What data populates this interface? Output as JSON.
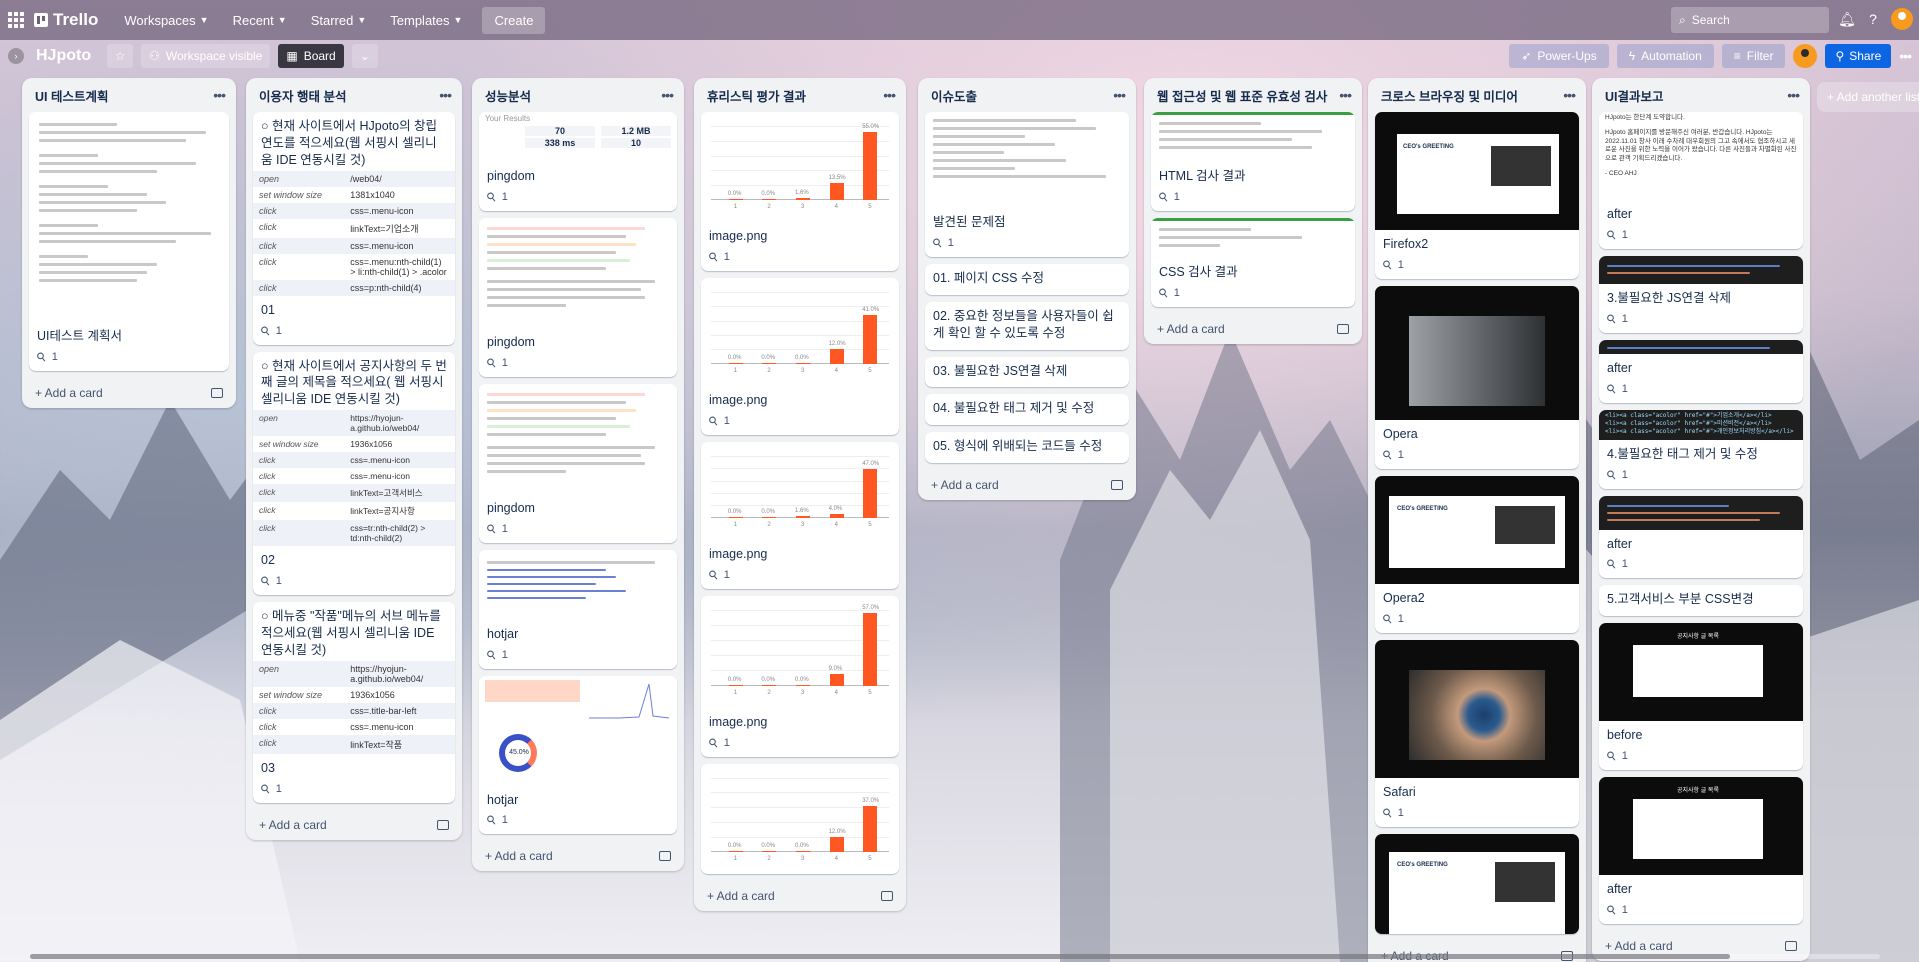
{
  "topnav": {
    "brand": "Trello",
    "menus": [
      "Workspaces",
      "Recent",
      "Starred",
      "Templates"
    ],
    "create_label": "Create",
    "search_placeholder": "Search"
  },
  "board": {
    "title": "HJpoto",
    "visibility_label": "Workspace visible",
    "view_label": "Board",
    "powerups_label": "Power-Ups",
    "automation_label": "Automation",
    "filter_label": "Filter",
    "share_label": "Share",
    "add_list_label": "+ Add another list"
  },
  "add_card_label": "+ Add a card",
  "lists": [
    {
      "title": "UI 테스트계획",
      "cards": [
        {
          "title": "UI테스트 계획서",
          "attachments": "1"
        }
      ]
    },
    {
      "title": "이용자 행태 분석",
      "cards": [
        {
          "title": "○ 현재 사이트에서 HJpoto의 창립 연도를 적으세요(웹 서핑시 셀리니움 IDE 연동시킬 것)",
          "rows": [
            [
              "open",
              "/web04/"
            ],
            [
              "set window size",
              "1381x1040"
            ],
            [
              "click",
              "css=.menu-icon"
            ],
            [
              "click",
              "linkText=기업소개"
            ],
            [
              "click",
              "css=.menu-icon"
            ],
            [
              "click",
              "css=.menu:nth-child(1) > li:nth-child(1) > .acolor"
            ],
            [
              "click",
              "css=p:nth-child(4)"
            ]
          ],
          "label": "01",
          "attachments": "1"
        },
        {
          "title": "○ 현재 사이트에서 공지사항의 두 번째 글의 제목을 적으세요( 웹 서핑시 셀리니움 IDE 연동시킬 것)",
          "rows": [
            [
              "open",
              "https://hyojun-a.github.io/web04/"
            ],
            [
              "set window size",
              "1936x1056"
            ],
            [
              "click",
              "css=.menu-icon"
            ],
            [
              "click",
              "css=.menu-icon"
            ],
            [
              "click",
              "linkText=고객서비스"
            ],
            [
              "click",
              "linkText=공지사항"
            ],
            [
              "click",
              "css=tr:nth-child(2) > td:nth-child(2)"
            ]
          ],
          "label": "02",
          "attachments": "1"
        },
        {
          "title": "○ 메뉴중 \"작품\"메뉴의 서브 메뉴를 적으세요(웹 서핑시 셀리니움 IDE 연동시킬 것)",
          "rows": [
            [
              "open",
              "https://hyojun-a.github.io/web04/"
            ],
            [
              "set window size",
              "1936x1056"
            ],
            [
              "click",
              "css=.title-bar-left"
            ],
            [
              "click",
              "css=.menu-icon"
            ],
            [
              "click",
              "linkText=작품"
            ]
          ],
          "label": "03",
          "attachments": "1"
        }
      ]
    },
    {
      "title": "성능분석",
      "cards": [
        {
          "title": "pingdom",
          "attachments": "1",
          "cover_heading": "Your Results",
          "stats": [
            "70",
            "1.2 MB",
            "338 ms",
            "10"
          ]
        },
        {
          "title": "pingdom",
          "attachments": "1"
        },
        {
          "title": "pingdom",
          "attachments": "1"
        },
        {
          "title": "hotjar",
          "attachments": "1"
        },
        {
          "title": "hotjar",
          "attachments": "1",
          "donut_label": "45.0%"
        }
      ]
    },
    {
      "title": "휴리스틱 평가 결과",
      "cards": [
        {
          "title": "image.png",
          "attachments": "1",
          "chart_data": {
            "type": "bar",
            "categories": [
              "1",
              "2",
              "3",
              "4",
              "5"
            ],
            "values": [
              0.0,
              0.0,
              1.6,
              13.5,
              55.0
            ]
          }
        },
        {
          "title": "image.png",
          "attachments": "1",
          "chart_data": {
            "type": "bar",
            "categories": [
              "1",
              "2",
              "3",
              "4",
              "5"
            ],
            "values": [
              0.0,
              0.0,
              0.0,
              12.0,
              41.0
            ]
          }
        },
        {
          "title": "image.png",
          "attachments": "1",
          "chart_data": {
            "type": "bar",
            "categories": [
              "1",
              "2",
              "3",
              "4",
              "5"
            ],
            "values": [
              0.0,
              0.0,
              1.6,
              4.0,
              47.0
            ]
          }
        },
        {
          "title": "image.png",
          "attachments": "1",
          "chart_data": {
            "type": "bar",
            "categories": [
              "1",
              "2",
              "3",
              "4",
              "5"
            ],
            "values": [
              0.0,
              0.0,
              0.0,
              9.0,
              57.0
            ]
          }
        },
        {
          "title": "",
          "attachments": "",
          "chart_data": {
            "type": "bar",
            "categories": [
              "1",
              "2",
              "3",
              "4",
              "5"
            ],
            "values": [
              0.0,
              0.0,
              0.0,
              12.0,
              37.0
            ]
          }
        }
      ]
    },
    {
      "title": "이슈도출",
      "cards": [
        {
          "title": "발견된 문제점",
          "attachments": "1"
        },
        {
          "title": "01. 페이지 CSS 수정"
        },
        {
          "title": "02. 중요한 정보들을 사용자들이 쉽게 확인 할 수 있도록 수정"
        },
        {
          "title": "03. 불필요한 JS연결 삭제"
        },
        {
          "title": "04. 불필요한 태그 제거 및 수정"
        },
        {
          "title": "05. 형식에 위배되는 코드들 수정"
        }
      ]
    },
    {
      "title": "웹 접근성 및 웹 표준 유효성 검사",
      "cards": [
        {
          "title": "HTML 검사 결과",
          "attachments": "1"
        },
        {
          "title": "CSS 검사 결과",
          "attachments": "1"
        }
      ]
    },
    {
      "title": "크로스 브라우징 및 미디어",
      "cards": [
        {
          "title": "Firefox2",
          "attachments": "1",
          "cover_caption": "CEO's GREETING"
        },
        {
          "title": "Opera",
          "attachments": "1"
        },
        {
          "title": "Opera2",
          "attachments": "1",
          "cover_caption": "CEO's GREETING"
        },
        {
          "title": "Safari",
          "attachments": "1"
        },
        {
          "title": "",
          "cover_caption": "CEO's GREETING"
        }
      ]
    },
    {
      "title": "UI결과보고",
      "cards": [
        {
          "title": "after",
          "attachments": "1",
          "intro": "HJpoto는 한단계 도약합니다.",
          "text": "HJpoto 홈페이지를 방문해주신 여러분, 반갑습니다. HJpoto는 2022.11.01 창사 이래 수차례 대우회원의 그고 속에서도 협조하시고 새로운 사진을 위한 노력을 이어가 왔습니다. 다른 사진들과 차별화된 사진으로 관객 기획드리겠습니다.",
          "sign": "- CEO AHJ"
        },
        {
          "title": "3.불필요한 JS연결 삭제",
          "attachments": "1"
        },
        {
          "title": "after",
          "attachments": "1"
        },
        {
          "title": "4.불필요한 태그 제거 및 수정",
          "attachments": "1",
          "code": [
            "<li><a class=\"acolor\" href=\"#\">기업소개</a></li>",
            "<li><a class=\"acolor\" href=\"#\">미션비전</a></li>",
            "<li><a class=\"acolor\" href=\"#\">개인정보처리방침</a></li>"
          ]
        },
        {
          "title": "after",
          "attachments": "1"
        },
        {
          "title": "5.고객서비스 부분 CSS변경"
        },
        {
          "title": "before",
          "attachments": "1",
          "cover_heading": "공지사항 글 목록"
        },
        {
          "title": "after",
          "attachments": "1",
          "cover_heading": "공지사항 글 목록"
        }
      ]
    }
  ]
}
